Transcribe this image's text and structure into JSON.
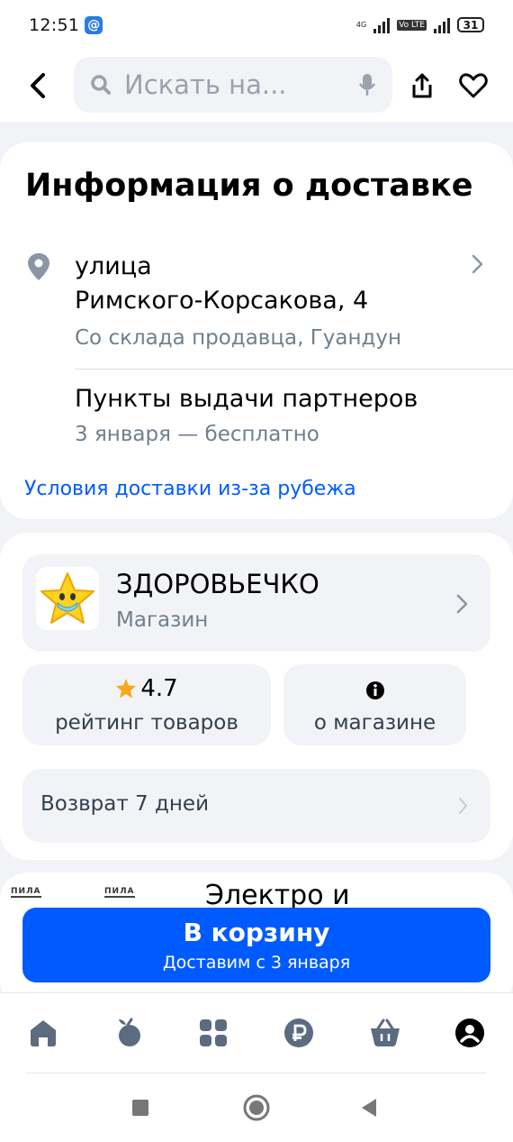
{
  "status": {
    "time": "12:51",
    "network_1": "4G",
    "network_2": "Vo LTE",
    "battery": "31"
  },
  "header": {
    "search_placeholder": "Искать на..."
  },
  "delivery": {
    "title": "Информация о доставке",
    "address_line1": "улица",
    "address_line2": "Римского-Корсакова, 4",
    "address_sub": "Со склада продавца, Гуандун",
    "pickup_title": "Пункты выдачи партнеров",
    "pickup_sub": "3 января — бесплатно",
    "terms_link": "Условия доставки из-за рубежа"
  },
  "store": {
    "name": "ЗДОРОВЬЕЧКО",
    "type": "Магазин",
    "rating_value": "4.7",
    "rating_label": "рейтинг товаров",
    "about_label": "о магазине",
    "return_label": "Возврат 7 дней"
  },
  "peek": {
    "image_text_1": "ПИЛА",
    "image_text_2": "ПИЛА",
    "title": "Электро и"
  },
  "cart": {
    "label": "В корзину",
    "sub": "Доставим с 3 января"
  },
  "nav": {
    "items": [
      "home-icon",
      "fresh-icon",
      "catalog-icon",
      "ruble-icon",
      "cart-icon",
      "profile-icon"
    ]
  },
  "colors": {
    "accent": "#005bff",
    "text": "#001a34",
    "secondary": "#707f8d",
    "star": "#f9a81a",
    "background": "#f2f3f7"
  }
}
